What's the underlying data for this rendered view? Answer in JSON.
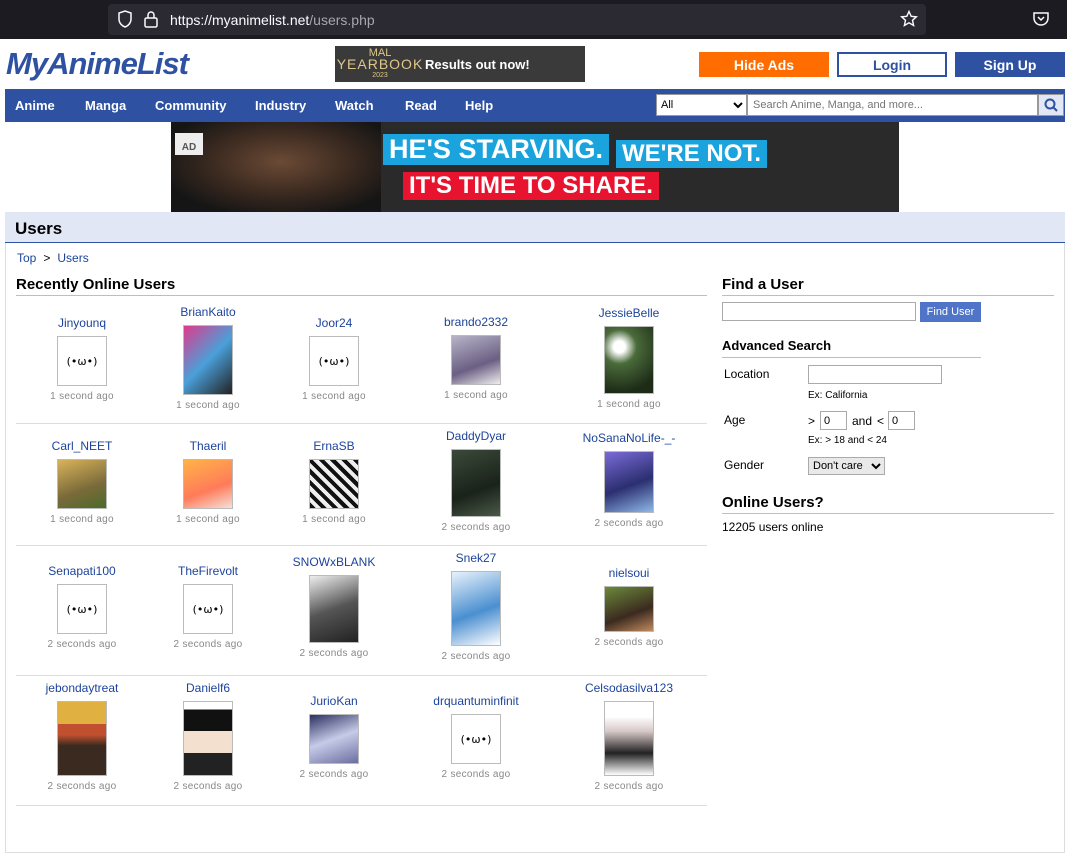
{
  "browser": {
    "url_host": "https://myanimelist.net",
    "url_path": "/users.php"
  },
  "header": {
    "logo": "MyAnimeList",
    "banner": {
      "line1": "MAL",
      "line2": "YEARBOOK",
      "line3": "2023",
      "cta": "Results out now!"
    },
    "hide_ads": "Hide Ads",
    "login": "Login",
    "signup": "Sign Up"
  },
  "nav": {
    "items": [
      "Anime",
      "Manga",
      "Community",
      "Industry",
      "Watch",
      "Read",
      "Help"
    ],
    "search_scope": "All",
    "search_placeholder": "Search Anime, Manga, and more..."
  },
  "ad": {
    "tag": "AD",
    "line1a": "HE'S STARVING.",
    "line1b": "WE'RE NOT.",
    "line2": "IT'S TIME TO SHARE."
  },
  "page": {
    "title": "Users",
    "breadcrumb": [
      "Top",
      ">",
      "Users"
    ],
    "recent_heading": "Recently Online Users"
  },
  "users": [
    {
      "name": "Jinyounq",
      "time": "1 second ago",
      "avatar": "default"
    },
    {
      "name": "BrianKaito",
      "time": "1 second ago",
      "avatar": "manga-cover"
    },
    {
      "name": "Joor24",
      "time": "1 second ago",
      "avatar": "default"
    },
    {
      "name": "brando2332",
      "time": "1 second ago",
      "avatar": "anime-boy"
    },
    {
      "name": "JessieBelle",
      "time": "1 second ago",
      "avatar": "flowers"
    },
    {
      "name": "Carl_NEET",
      "time": "1 second ago",
      "avatar": "anime-kid"
    },
    {
      "name": "Thaeril",
      "time": "1 second ago",
      "avatar": "anime-girl-orange"
    },
    {
      "name": "ErnaSB",
      "time": "1 second ago",
      "avatar": "manga-bw"
    },
    {
      "name": "DaddyDyar",
      "time": "2 seconds ago",
      "avatar": "dark-figure"
    },
    {
      "name": "NoSanaNoLife-_-",
      "time": "2 seconds ago",
      "avatar": "anime-girl-blue"
    },
    {
      "name": "Senapati100",
      "time": "2 seconds ago",
      "avatar": "default"
    },
    {
      "name": "TheFirevolt",
      "time": "2 seconds ago",
      "avatar": "default"
    },
    {
      "name": "SNOWxBLANK",
      "time": "2 seconds ago",
      "avatar": "manhwa-boy"
    },
    {
      "name": "Snek27",
      "time": "2 seconds ago",
      "avatar": "anime-blue-art"
    },
    {
      "name": "nielsoui",
      "time": "2 seconds ago",
      "avatar": "zoro"
    },
    {
      "name": "jebondaytreat",
      "time": "2 seconds ago",
      "avatar": "luffy"
    },
    {
      "name": "Danielf6",
      "time": "2 seconds ago",
      "avatar": "anime-boy-black"
    },
    {
      "name": "JurioKan",
      "time": "2 seconds ago",
      "avatar": "anime-girl-white"
    },
    {
      "name": "drquantuminfinit",
      "time": "2 seconds ago",
      "avatar": "default"
    },
    {
      "name": "Celsodasilva123",
      "time": "2 seconds ago",
      "avatar": "bunny-girl"
    }
  ],
  "default_avatar_kaomoji": "(•ω•)",
  "sidebar": {
    "find_heading": "Find a User",
    "find_button": "Find User",
    "advanced_heading": "Advanced Search",
    "location_label": "Location",
    "location_hint": "Ex: California",
    "age_label": "Age",
    "age_gt": ">",
    "age_and": "and",
    "age_lt": "<",
    "age_min": "0",
    "age_max": "0",
    "age_hint": "Ex: > 18 and < 24",
    "gender_label": "Gender",
    "gender_value": "Don't care",
    "online_heading": "Online Users?",
    "online_count": "12205 users online"
  },
  "colors": {
    "brand": "#2e51a2",
    "orange": "#ff6c00",
    "title_bg": "#e1e7f5",
    "link": "#1c439b"
  }
}
